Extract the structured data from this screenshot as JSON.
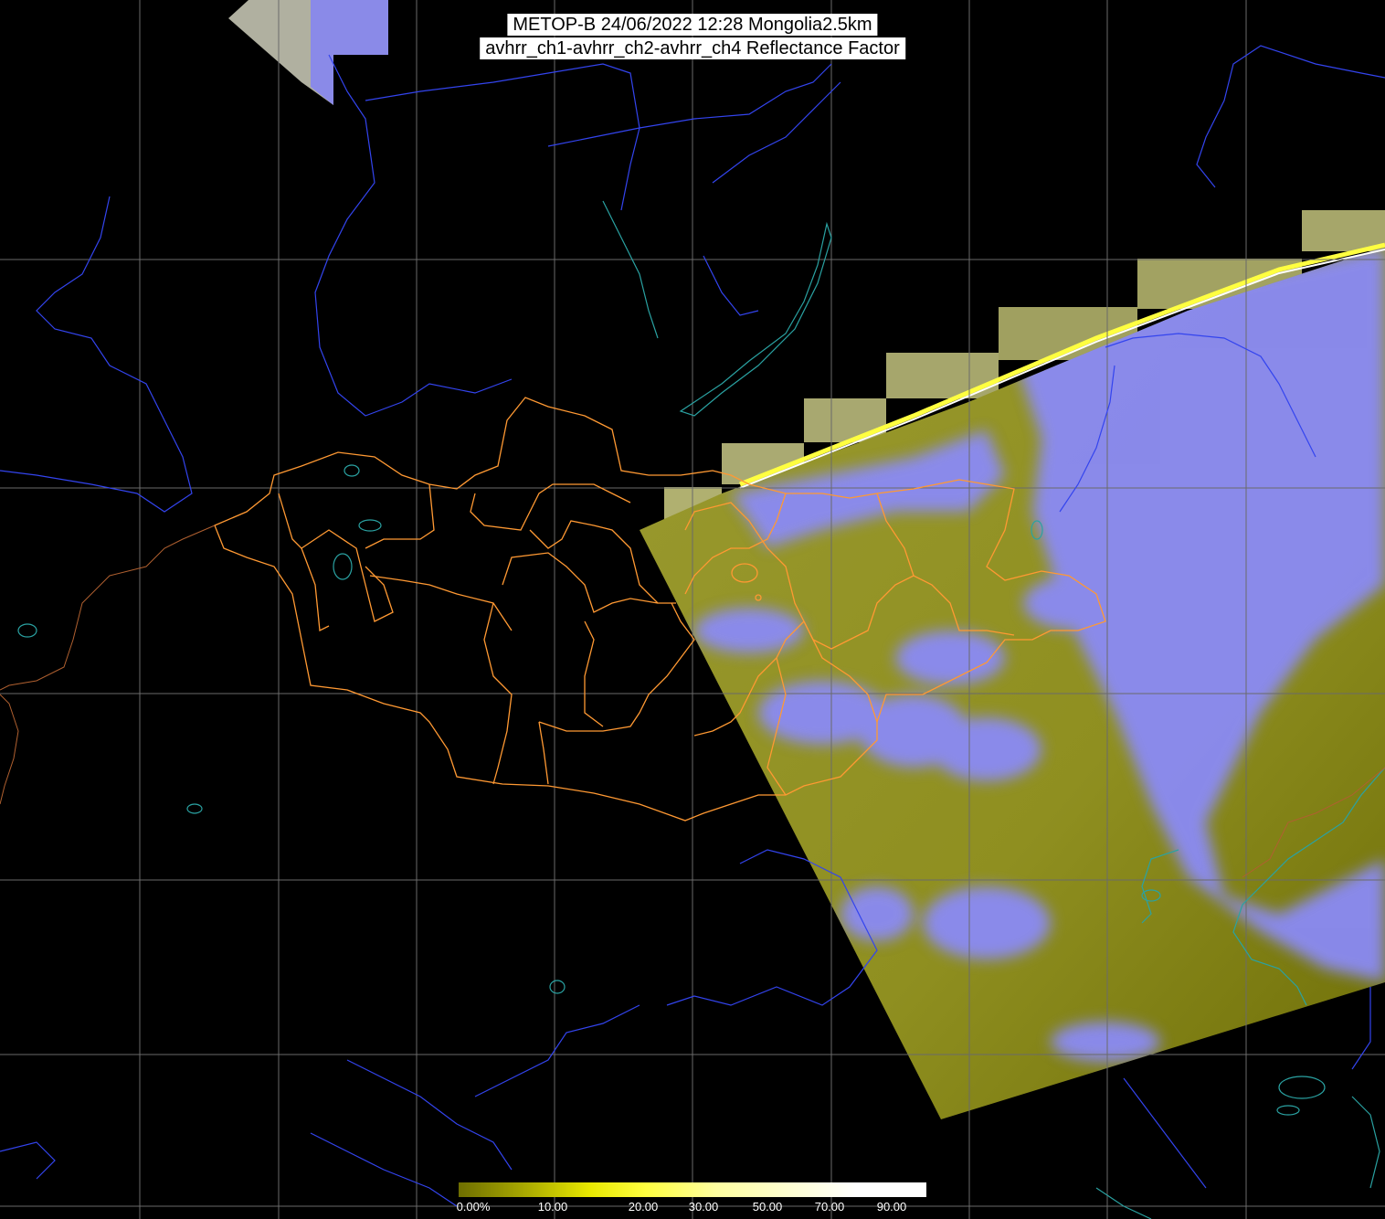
{
  "header": {
    "title_line1": "METOP-B 24/06/2022 12:28 Mongolia2.5km",
    "title_line2": "avhrr_ch1-avhrr_ch2-avhrr_ch4 Reflectance Factor"
  },
  "colorbar": {
    "labels": [
      "0.00%",
      "10.00",
      "20.00",
      "30.00",
      "50.00",
      "70.00",
      "90.00"
    ],
    "colors": [
      "#6e6e00",
      "#a8a800",
      "#e8e800",
      "#ffff40",
      "#ffffa0",
      "#ffffd0",
      "#ffffff"
    ]
  },
  "map": {
    "background": "#000000",
    "swath_color": "#8a8a1e",
    "cloud_color": "#8888ff",
    "graticule_color": "#6a6a6a",
    "border_color": "#ff9933",
    "river_color": "#3344ee",
    "coast_color": "#2aa2a2"
  }
}
